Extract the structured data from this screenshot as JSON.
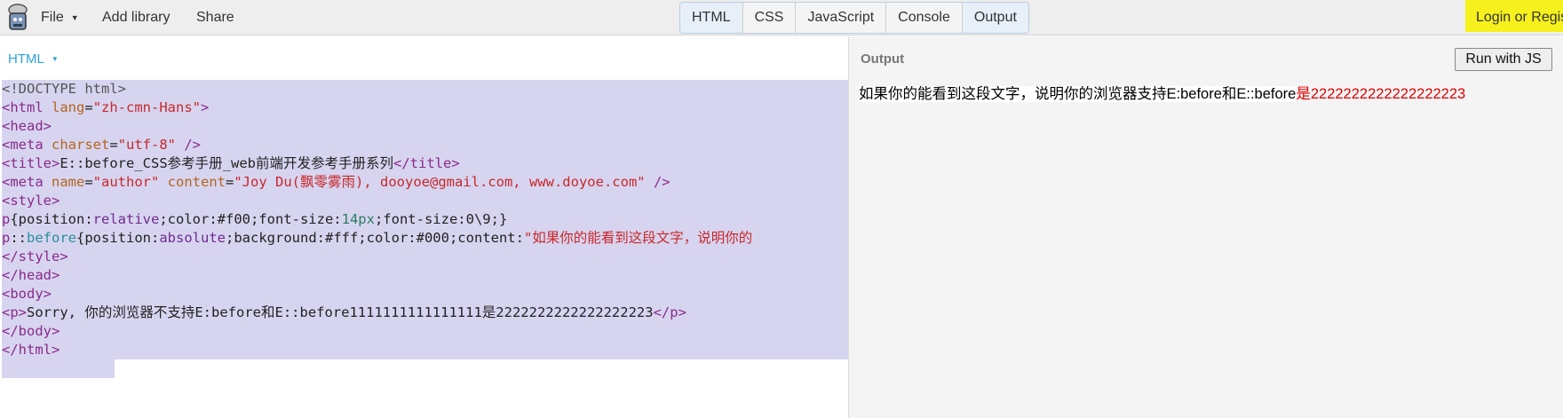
{
  "topbar": {
    "logo_icon": "jsbin-logo-icon",
    "file_label": "File",
    "add_library_label": "Add library",
    "share_label": "Share",
    "tabs": [
      {
        "label": "HTML",
        "active": true
      },
      {
        "label": "CSS",
        "active": false
      },
      {
        "label": "JavaScript",
        "active": false
      },
      {
        "label": "Console",
        "active": false
      },
      {
        "label": "Output",
        "active": true
      }
    ],
    "login_label": "Login or Regis"
  },
  "editor": {
    "panel_label": "HTML",
    "lines": [
      "<!DOCTYPE html>",
      "<html lang=\"zh-cmn-Hans\">",
      "<head>",
      "<meta charset=\"utf-8\" />",
      "<title>E::before_CSS参考手册_web前端开发参考手册系列</title>",
      "<meta name=\"author\" content=\"Joy Du(飘零雾雨), dooyoe@gmail.com, www.doyoe.com\" />",
      "<style>",
      "p{position:relative;color:#f00;font-size:14px;font-size:0\\9;}",
      "p::before{position:absolute;background:#fff;color:#000;content:\"如果你的能看到这段文字，说明你的",
      "</style>",
      "</head>",
      "<body>",
      "<p>Sorry, 你的浏览器不支持E:before和E::before1111111111111111是2222222222222222223</p>",
      "</body>",
      "</html>"
    ]
  },
  "output": {
    "panel_label": "Output",
    "run_button_label": "Run with JS",
    "text_before": "如果你的能看到这段文字，说明你的浏览器支持E:before和E::before",
    "text_after": "是2222222222222222223"
  },
  "colors": {
    "tag": "#8a2a8a",
    "attribute": "#b5651d",
    "string": "#c82828",
    "selection": "#d7d4f0",
    "accent": "#2aa1d8",
    "login_bg": "#f6f11d",
    "output_red": "#e00000"
  }
}
